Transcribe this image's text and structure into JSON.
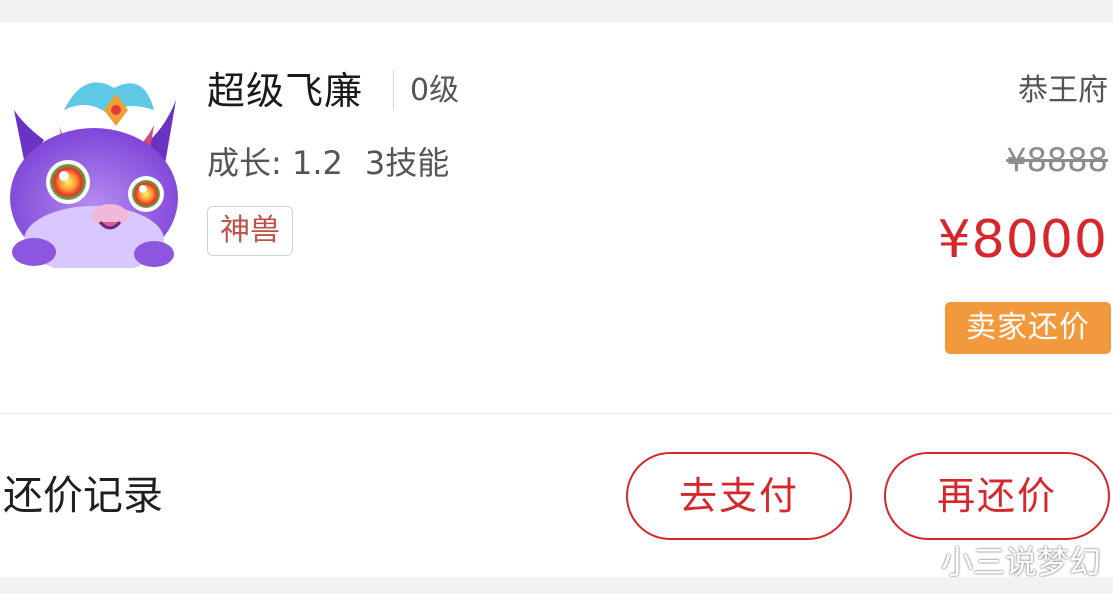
{
  "pet": {
    "name": "超级飞廉",
    "level": "0级",
    "growth": "成长: 1.2",
    "skills": "3技能",
    "tag": "神兽",
    "avatar_icon": "purple-dragon-pet-avatar"
  },
  "server": "恭王府",
  "pricing": {
    "original_price": "¥8888",
    "current_price": "¥8000",
    "badge": "卖家还价"
  },
  "footer": {
    "record_label": "还价记录",
    "pay_button": "去支付",
    "counter_button": "再还价"
  },
  "watermark": "小三说梦幻",
  "colors": {
    "price_red": "#d8262a",
    "badge_orange": "#f3993d",
    "tag_red": "#c0504a"
  }
}
